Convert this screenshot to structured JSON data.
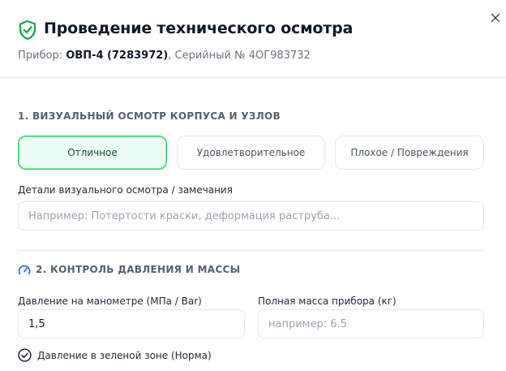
{
  "header": {
    "title": "Проведение технического осмотра",
    "device_label": "Прибор:",
    "device_name": "ОВП-4 (7283972)",
    "serial": ", Серийный № 4ОГ983732"
  },
  "section_visual": {
    "title": "1. ВИЗУАЛЬНЫЙ ОСМОТР КОРПУСА И УЗЛОВ",
    "options": [
      {
        "label": "Отличное",
        "selected": true
      },
      {
        "label": "Удовлетворительное",
        "selected": false
      },
      {
        "label": "Плохое / Повреждения",
        "selected": false
      }
    ],
    "details_label": "Детали визуального осмотра / замечания",
    "details_placeholder": "Например: Потертости краски, деформация раструба...",
    "details_value": ""
  },
  "section_pressure": {
    "title": "2. КОНТРОЛЬ ДАВЛЕНИЯ И МАССЫ",
    "pressure_label": "Давление на манометре (МПа / Bar)",
    "pressure_value": "1,5",
    "mass_label": "Полная масса прибора (кг)",
    "mass_placeholder": "например: 6.5",
    "green_zone_label": "Давление в зеленой зоне (Норма)",
    "green_zone_checked": true
  },
  "colors": {
    "accent_green": "#22c55e",
    "selected_bg": "#ecfdf5",
    "icon_green": "#16a34a",
    "gauge_blue": "#2563eb"
  }
}
